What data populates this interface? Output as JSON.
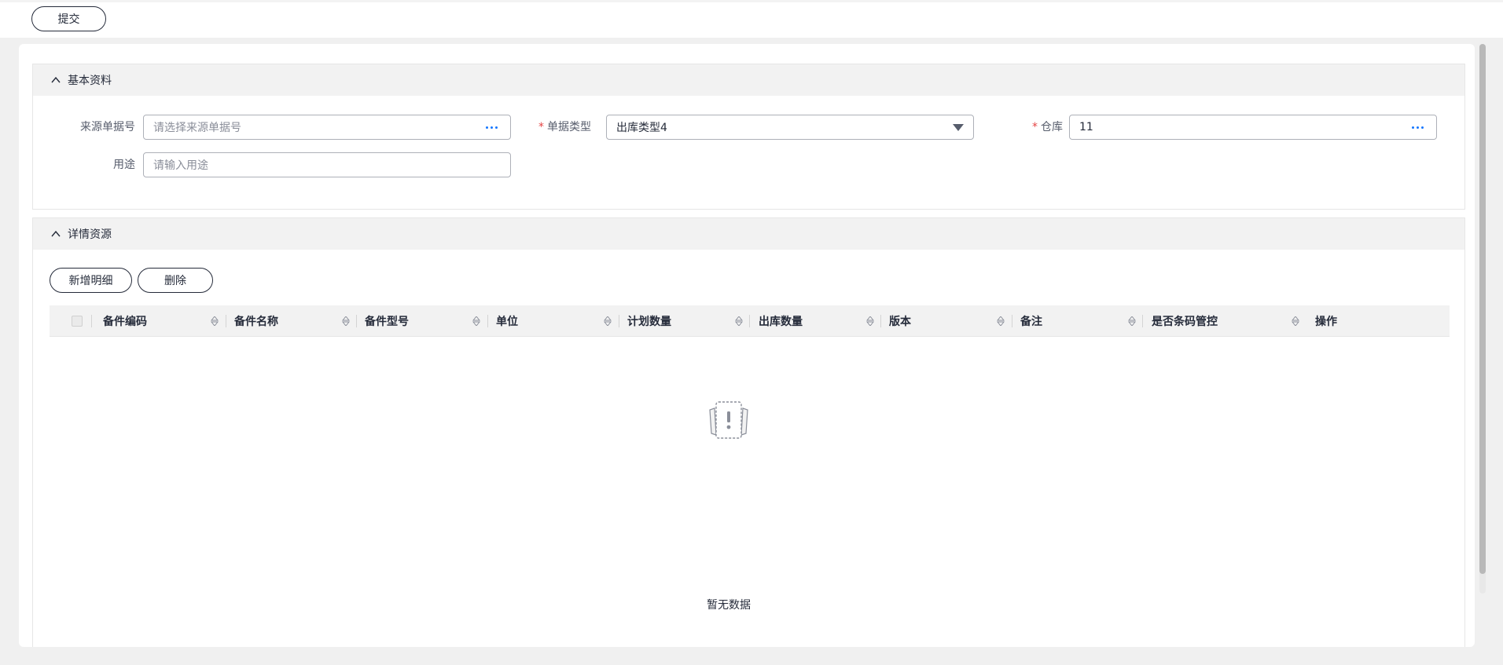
{
  "toolbar": {
    "submit_label": "提交"
  },
  "basic_section": {
    "title": "基本资料",
    "fields": {
      "source_no": {
        "label": "来源单据号",
        "placeholder": "请选择来源单据号"
      },
      "doc_type": {
        "label": "单据类型",
        "required_mark": "*",
        "value": "出库类型4"
      },
      "warehouse": {
        "label": "仓库",
        "required_mark": "*",
        "value": "11"
      },
      "purpose": {
        "label": "用途",
        "placeholder": "请输入用途"
      }
    }
  },
  "detail_section": {
    "title": "详情资源",
    "add_label": "新增明细",
    "delete_label": "删除",
    "columns": [
      "备件编码",
      "备件名称",
      "备件型号",
      "单位",
      "计划数量",
      "出库数量",
      "版本",
      "备注",
      "是否条码管控",
      "操作"
    ],
    "empty_text": "暂无数据"
  },
  "colors": {
    "accent": "#1476ff",
    "required": "#e54545",
    "header_bg": "#f2f2f2"
  }
}
